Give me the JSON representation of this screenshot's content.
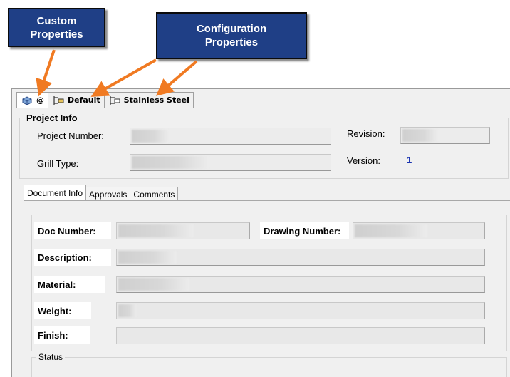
{
  "callouts": {
    "custom": "Custom Properties",
    "config": "Configuration Properties"
  },
  "config_tabs": [
    {
      "label": "@",
      "icon": "part-icon"
    },
    {
      "label": "Default",
      "icon": "configuration-icon"
    },
    {
      "label": "Stainless Steel",
      "icon": "configuration-icon"
    }
  ],
  "project_info": {
    "title": "Project Info",
    "project_number_label": "Project Number:",
    "grill_type_label": "Grill Type:",
    "revision_label": "Revision:",
    "version_label": "Version:",
    "version_value": "1"
  },
  "inner_tabs": [
    "Document Info",
    "Approvals",
    "Comments"
  ],
  "document_info": {
    "doc_number_label": "Doc Number:",
    "drawing_number_label": "Drawing Number:",
    "description_label": "Description:",
    "material_label": "Material:",
    "weight_label": "Weight:",
    "finish_label": "Finish:"
  },
  "status": {
    "title": "Status"
  },
  "colors": {
    "callout": "#1f3f86",
    "arrow": "#f07a22",
    "link_value": "#1a33b0"
  }
}
